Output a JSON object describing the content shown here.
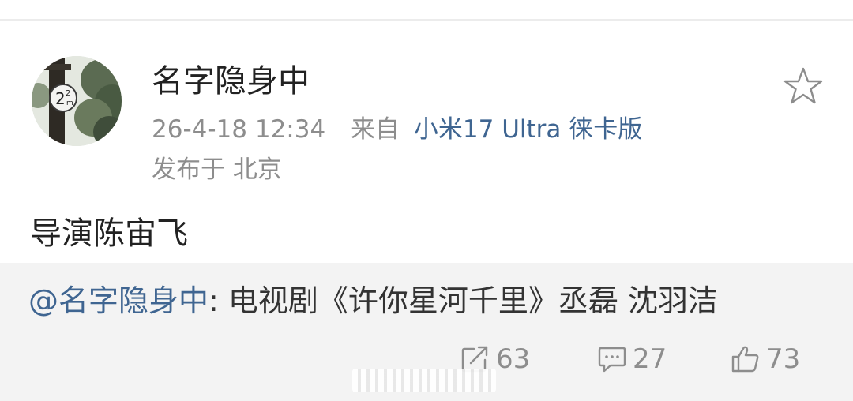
{
  "post": {
    "username": "名字隐身中",
    "timestamp": "26-4-18 12:34",
    "source_prefix": "来自",
    "device": "小米17 Ultra 徕卡版",
    "location": "发布于 北京",
    "text": "导演陈宙飞"
  },
  "repost": {
    "mention": "@名字隐身中",
    "separator": ":",
    "text": " 电视剧《许你星河千里》丞磊 沈羽洁"
  },
  "actions": {
    "share_count": "63",
    "comment_count": "27",
    "like_count": "73"
  },
  "avatar": {
    "sign_text": "2",
    "sign_sup": "2",
    "sign_unit": "m"
  },
  "colors": {
    "link": "#3f6591",
    "meta": "#8d8d8d",
    "text": "#222222",
    "repost_bg": "#f3f3f3"
  },
  "icons": {
    "favorite": "star-outline-icon",
    "share": "share-square-arrow-icon",
    "comment": "comment-bubble-icon",
    "like": "thumbs-up-icon"
  }
}
